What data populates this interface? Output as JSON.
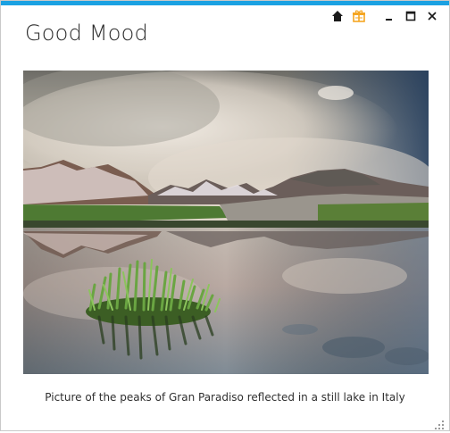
{
  "window": {
    "title": "Good Mood",
    "accent_color": "#1ba1e2",
    "controls": [
      "home-icon",
      "gift-icon",
      "minimize-icon",
      "maximize-icon",
      "close-icon"
    ]
  },
  "content": {
    "image_label": "",
    "caption": "Picture of the peaks of Gran Paradiso reflected in a still lake in Italy"
  },
  "colors": {
    "gift_icon": "#f5a623",
    "text": "#2b2b2b"
  }
}
